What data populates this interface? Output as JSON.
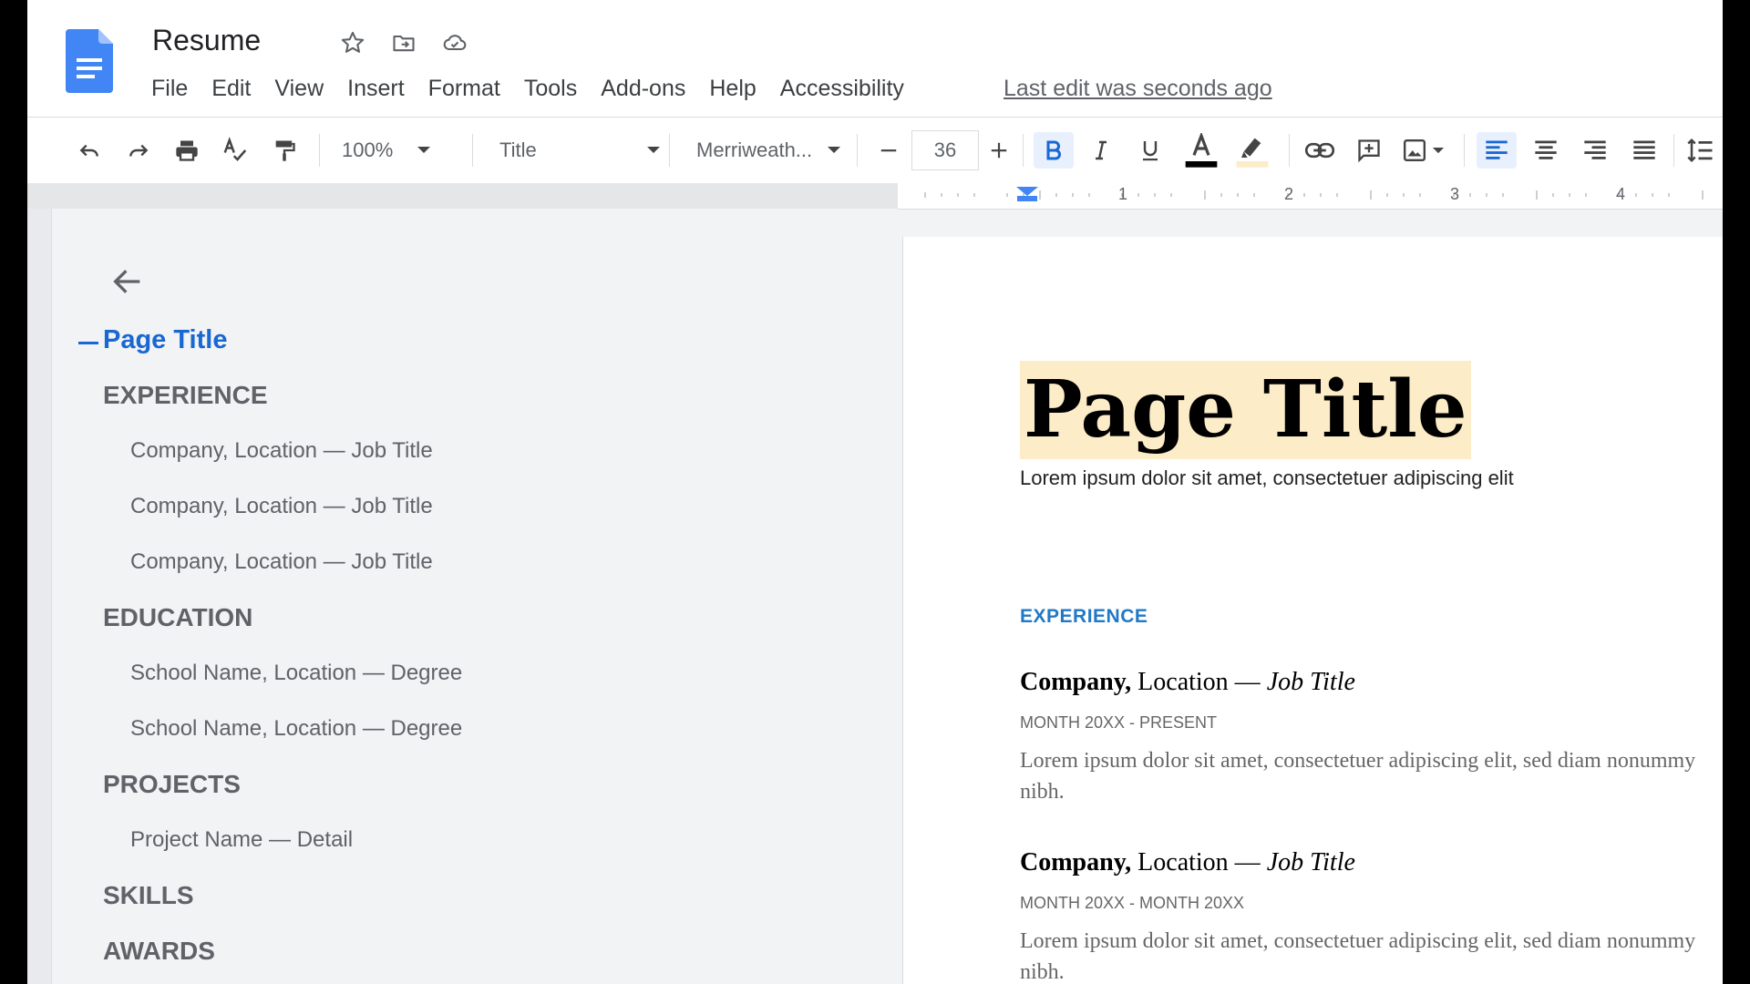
{
  "header": {
    "title": "Resume",
    "menu": [
      "File",
      "Edit",
      "View",
      "Insert",
      "Format",
      "Tools",
      "Add-ons",
      "Help",
      "Accessibility"
    ],
    "last_edit": "Last edit was seconds ago"
  },
  "toolbar": {
    "zoom": "100%",
    "style": "Title",
    "font": "Merriweath...",
    "font_size": "36"
  },
  "ruler": {
    "marks": [
      "1",
      "2",
      "3",
      "4"
    ]
  },
  "outline": {
    "title": "Page Title",
    "items": [
      {
        "level": 1,
        "text": "EXPERIENCE"
      },
      {
        "level": 2,
        "text": "Company, Location — Job Title"
      },
      {
        "level": 2,
        "text": "Company, Location — Job Title"
      },
      {
        "level": 2,
        "text": "Company, Location — Job Title"
      },
      {
        "level": 1,
        "text": "EDUCATION"
      },
      {
        "level": 2,
        "text": "School Name, Location — Degree"
      },
      {
        "level": 2,
        "text": "School Name, Location — Degree"
      },
      {
        "level": 1,
        "text": "PROJECTS"
      },
      {
        "level": 2,
        "text": "Project Name — Detail"
      },
      {
        "level": 1,
        "text": "SKILLS"
      },
      {
        "level": 1,
        "text": "AWARDS"
      }
    ]
  },
  "document": {
    "title": "Page Title",
    "subtitle": "Lorem ipsum dolor sit amet, consectetuer adipiscing elit",
    "section": "EXPERIENCE",
    "jobs": [
      {
        "company": "Company,",
        "location": " Location — ",
        "role": "Job Title",
        "dates": "MONTH 20XX - PRESENT",
        "desc": "Lorem ipsum dolor sit amet, consectetuer adipiscing elit, sed diam nonummy nibh."
      },
      {
        "company": "Company,",
        "location": " Location — ",
        "role": "Job Title",
        "dates": "MONTH 20XX - MONTH 20XX",
        "desc": "Lorem ipsum dolor sit amet, consectetuer adipiscing elit, sed diam nonummy nibh."
      }
    ]
  },
  "colors": {
    "accent": "#1967d2",
    "title_highlight": "#fcecc7",
    "section_blue": "#2079c7"
  }
}
